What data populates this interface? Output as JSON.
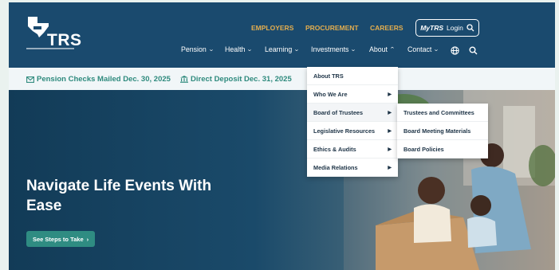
{
  "brand": {
    "logo_text": "TRS"
  },
  "top_nav": [
    "EMPLOYERS",
    "PROCUREMENT",
    "CAREERS"
  ],
  "login": {
    "brand": "MyTRS",
    "label": "Login"
  },
  "main_nav": [
    "Pension",
    "Health",
    "Learning",
    "Investments",
    "About",
    "Contact"
  ],
  "alerts": [
    "Pension Checks Mailed Dec. 30, 2025",
    "Direct Deposit Dec. 31, 2025"
  ],
  "hero": {
    "title": "Navigate Life Events With Ease",
    "button": "See Steps to Take"
  },
  "about_menu": {
    "items": [
      "About TRS",
      "Who We Are",
      "Board of Trustees",
      "Legislative Resources",
      "Ethics & Audits",
      "Media Relations"
    ],
    "expanded": "Board of Trustees",
    "submenu": [
      "Trustees and Committees",
      "Board Meeting Materials",
      "Board Policies"
    ]
  },
  "colors": {
    "header": "#1a4a6e",
    "gold": "#e3ad4e",
    "teal": "#2e8a7d",
    "button": "#2f8c82"
  }
}
